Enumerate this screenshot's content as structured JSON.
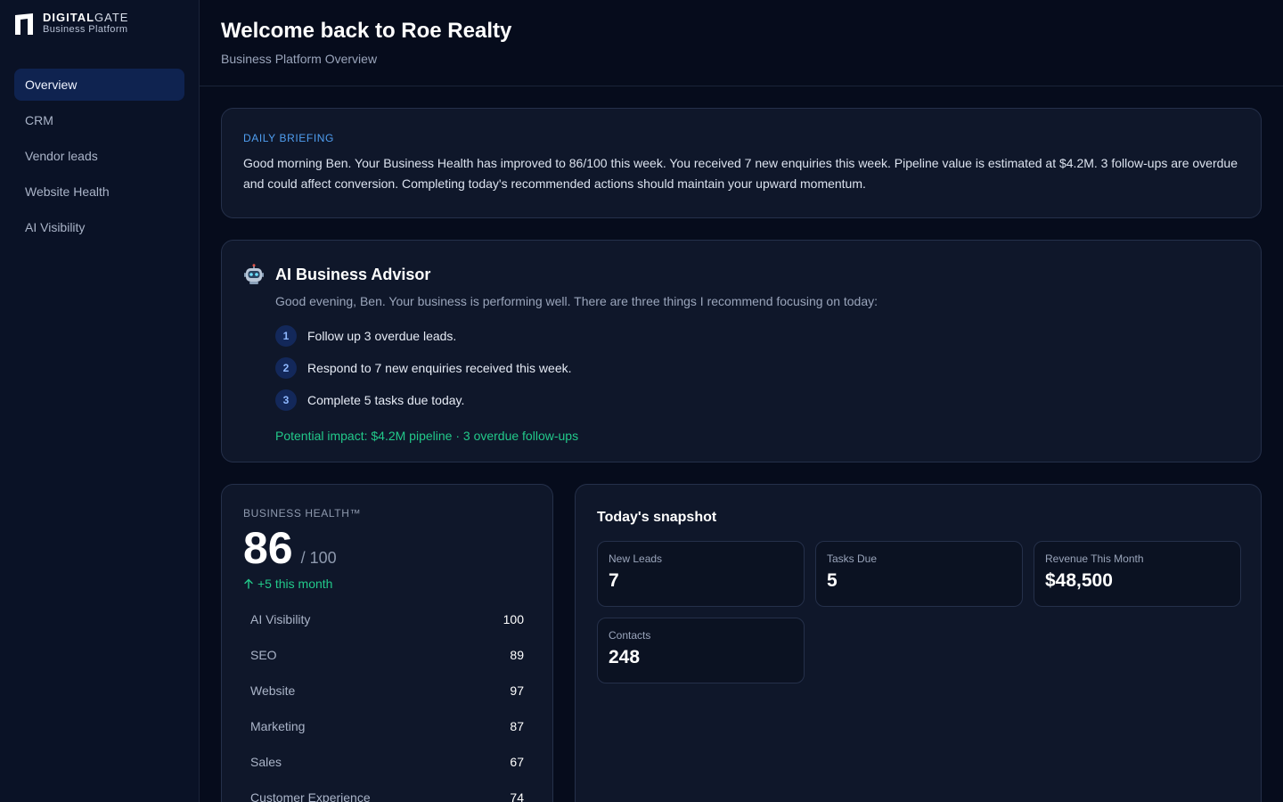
{
  "brand": {
    "name_bold": "DIGITAL",
    "name_light": "GATE",
    "subtitle": "Business Platform"
  },
  "sidebar": {
    "items": [
      {
        "label": "Overview",
        "active": true
      },
      {
        "label": "CRM"
      },
      {
        "label": "Vendor leads"
      },
      {
        "label": "Website Health"
      },
      {
        "label": "AI Visibility"
      }
    ]
  },
  "header": {
    "title": "Welcome back to Roe Realty",
    "subtitle": "Business Platform Overview"
  },
  "briefing": {
    "label": "DAILY BRIEFING",
    "text": "Good morning Ben. Your Business Health has improved to 86/100 this week. You received 7 new enquiries this week. Pipeline value is estimated at $4.2M. 3 follow-ups are overdue and could affect conversion. Completing today's recommended actions should maintain your upward momentum."
  },
  "advisor": {
    "icon": "robot-icon",
    "title": "AI Business Advisor",
    "intro": "Good evening, Ben. Your business is performing well. There are three things I recommend focusing on today:",
    "recommendations": [
      {
        "num": "1",
        "text": "Follow up 3 overdue leads."
      },
      {
        "num": "2",
        "text": "Respond to 7 new enquiries received this week."
      },
      {
        "num": "3",
        "text": "Complete 5 tasks due today."
      }
    ],
    "impact": "Potential impact: $4.2M pipeline · 3 overdue follow-ups"
  },
  "health": {
    "label": "BUSINESS HEALTH™",
    "score": "86",
    "max": "/ 100",
    "trend": "+5 this month",
    "metrics": [
      {
        "name": "AI Visibility",
        "value": "100"
      },
      {
        "name": "SEO",
        "value": "89"
      },
      {
        "name": "Website",
        "value": "97"
      },
      {
        "name": "Marketing",
        "value": "87"
      },
      {
        "name": "Sales",
        "value": "67"
      },
      {
        "name": "Customer Experience",
        "value": "74"
      }
    ]
  },
  "snapshot": {
    "title": "Today's snapshot",
    "stats": [
      {
        "label": "New Leads",
        "value": "7"
      },
      {
        "label": "Tasks Due",
        "value": "5"
      },
      {
        "label": "Revenue This Month",
        "value": "$48,500"
      },
      {
        "label": "Contacts",
        "value": "248"
      }
    ]
  },
  "colors": {
    "accent": "#4f9ef0",
    "positive": "#22c98a",
    "active_nav": "#0f2350",
    "background": "#060c1c"
  }
}
